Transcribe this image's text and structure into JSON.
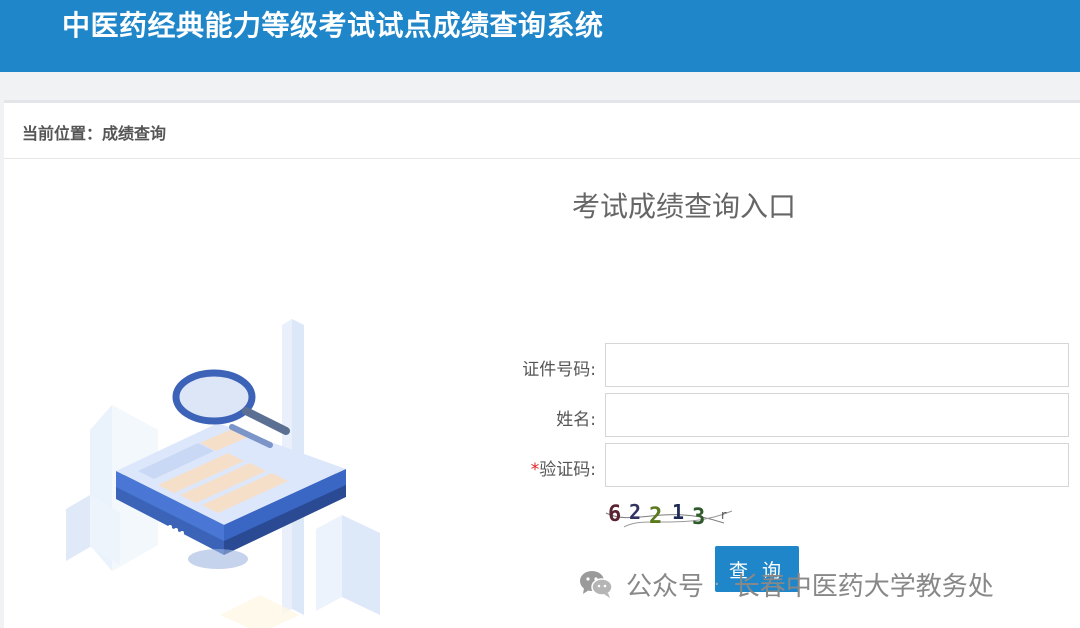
{
  "header": {
    "title": "中医药经典能力等级考试试点成绩查询系统"
  },
  "breadcrumb": {
    "text": "当前位置：成绩查询"
  },
  "form": {
    "title": "考试成绩查询入口",
    "id_label": "证件号码:",
    "id_value": "",
    "name_label": "姓名:",
    "name_value": "",
    "captcha_required_mark": "*",
    "captcha_label": "验证码:",
    "captcha_value": "",
    "captcha_image_text": "62213",
    "submit_label": "查 询"
  },
  "watermark": {
    "prefix": "公众号",
    "separator": "·",
    "name": "长春中医药大学教务处"
  },
  "icons": {
    "illustration": "document-search-illustration",
    "wechat": "wechat-icon"
  },
  "colors": {
    "brand": "#1e86c9",
    "required": "#e02020"
  }
}
